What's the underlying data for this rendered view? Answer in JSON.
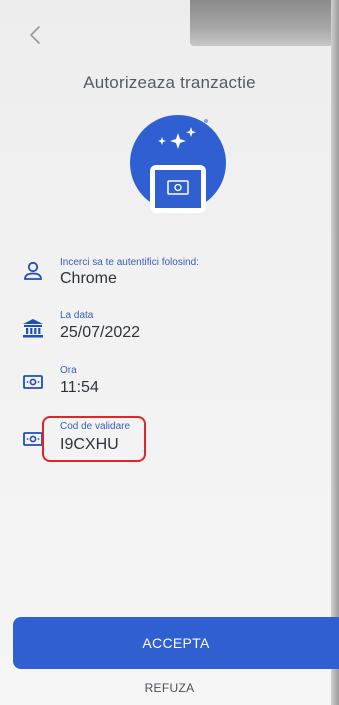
{
  "header": {
    "title": "Autorizeaza tranzactie"
  },
  "icons": {
    "back": "chevron-left-icon",
    "hero": "phone-sparkle-icon",
    "device": "user-icon",
    "date": "bank-icon",
    "time": "banknote-icon",
    "code": "banknote-icon"
  },
  "details": {
    "device": {
      "label": "Incerci sa te autentifici folosind:",
      "value": "Chrome"
    },
    "date": {
      "label": "La data",
      "value": "25/07/2022"
    },
    "time": {
      "label": "Ora",
      "value": "11:54"
    },
    "code": {
      "label": "Cod de validare",
      "value": "I9CXHU"
    }
  },
  "actions": {
    "accept_label": "ACCEPTA",
    "refuse_label": "REFUZA"
  },
  "colors": {
    "accent": "#2f5fd1",
    "icon": "#1f4fb0",
    "highlight": "#e1232d",
    "text": "#2d3339"
  }
}
